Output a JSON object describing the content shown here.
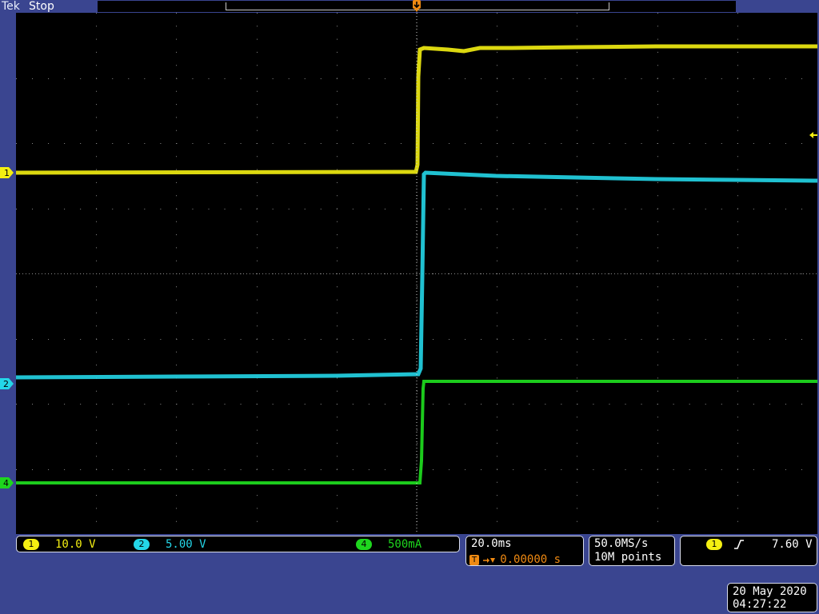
{
  "header": {
    "brand": "Tek",
    "acq_state": "Stop"
  },
  "trigger_marker": {
    "label": "T"
  },
  "colors": {
    "ch1": "#f4ef12",
    "ch2": "#24d6e8",
    "ch4": "#1ed61e",
    "grid": "#8a8a8a",
    "background": "#000000",
    "frame": "#3a4590",
    "trigger": "#f08a12"
  },
  "channels": [
    {
      "id": "1",
      "scale": "10.0 V",
      "color": "#f4ef12"
    },
    {
      "id": "2",
      "scale": "5.00 V",
      "color": "#24d6e8"
    },
    {
      "id": "4",
      "scale": "500mA",
      "color": "#1ed61e"
    }
  ],
  "timebase": {
    "scale": "20.0ms",
    "trigger_icon": "T",
    "delay": "0.00000 s"
  },
  "acquisition": {
    "sample_rate": "50.0MS/s",
    "record_length": "10M points"
  },
  "trigger": {
    "source": "1",
    "slope_icon": "rising-edge-icon",
    "level": "7.60 V"
  },
  "datetime": {
    "date": "20 May 2020",
    "time": "04:27:22"
  }
}
